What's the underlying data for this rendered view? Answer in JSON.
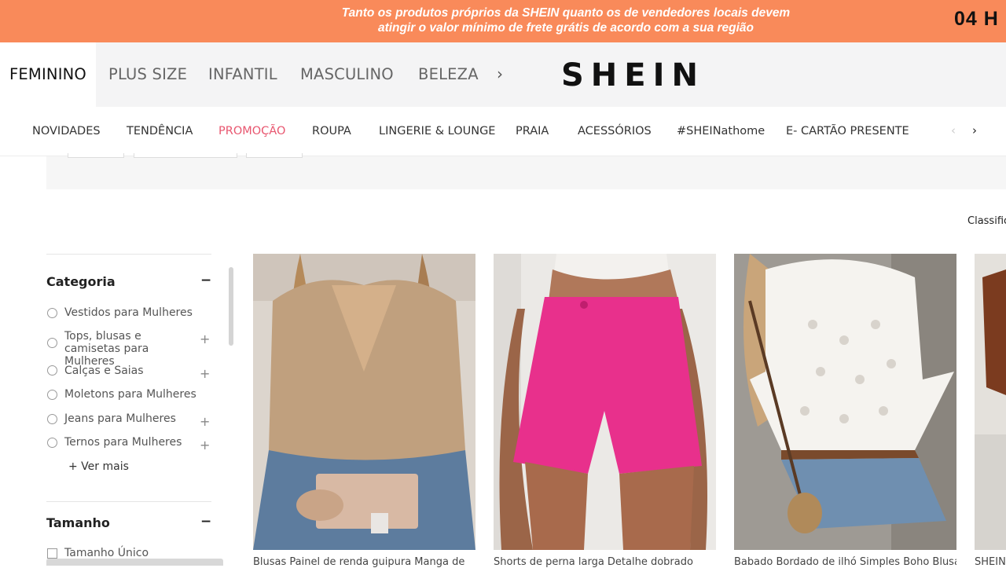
{
  "promo": {
    "line1": "Tanto os produtos próprios da SHEIN quanto os de vendedores locais devem",
    "line2": "atingir o valor mínimo de frete grátis de acordo com a sua região",
    "countdown": "04  H"
  },
  "top_nav": {
    "categories": [
      "FEMININO",
      "PLUS SIZE",
      "INFANTIL",
      "MASCULINO",
      "BELEZA"
    ],
    "more_arrow": "›",
    "logo": "SHEIN"
  },
  "sub_nav": {
    "items": [
      "NOVIDADES",
      "TENDÊNCIA",
      "PROMOÇÃO",
      "ROUPA",
      "LINGERIE & LOUNGE",
      "PRAIA",
      "ACESSÓRIOS",
      "#SHEINathome",
      "E- CARTÃO PRESENTE"
    ],
    "highlight_color": "#e8566f",
    "prev_arrow": "‹",
    "next_arrow": "›"
  },
  "sort": {
    "label": "Classific"
  },
  "sidebar": {
    "category_heading": "Categoria",
    "collapse_symbol": "−",
    "expand_symbol": "+",
    "categories": [
      {
        "label": "Vestidos para Mulheres",
        "expandable": false
      },
      {
        "label": "Tops, blusas e camisetas para Mulheres",
        "expandable": true
      },
      {
        "label": "Calças e Saias",
        "expandable": true
      },
      {
        "label": "Moletons para Mulheres",
        "expandable": false
      },
      {
        "label": "Jeans para Mulheres",
        "expandable": true
      },
      {
        "label": "Ternos para Mulheres",
        "expandable": true
      }
    ],
    "see_more": "+ Ver mais",
    "size_heading": "Tamanho",
    "size_options": [
      "Tamanho Único"
    ]
  },
  "products": [
    {
      "title": "Blusas Painel de renda guipura Manga de",
      "image_icon": "product-image-beige-top"
    },
    {
      "title": "Shorts de perna larga Detalhe dobrado",
      "image_icon": "product-image-pink-shorts"
    },
    {
      "title": "Babado Bordado de ilhó Simples Boho Blusa",
      "image_icon": "product-image-white-eyelet-blouse"
    },
    {
      "title": "SHEIN",
      "image_icon": "product-image-partial"
    }
  ],
  "colors": {
    "promo_bar": "#f98a5a",
    "top_nav_bg": "#f4f4f5",
    "accent_sale": "#e8566f"
  }
}
